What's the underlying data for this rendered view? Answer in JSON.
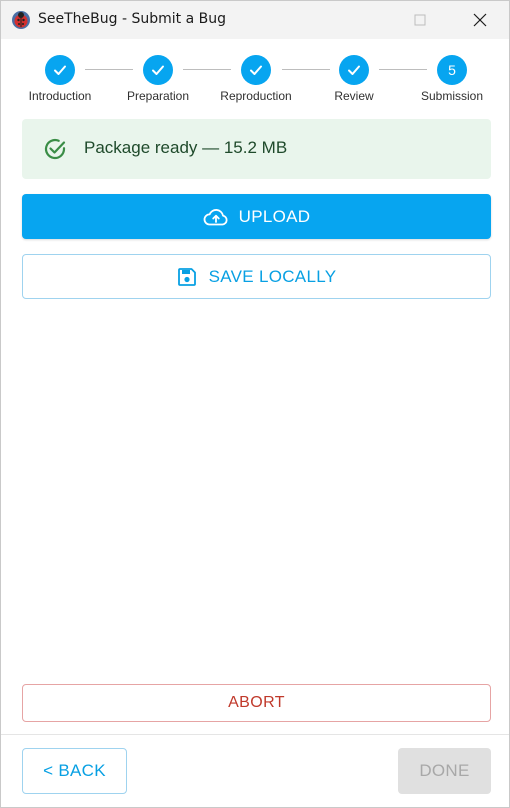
{
  "window": {
    "title": "SeeTheBug - Submit a Bug",
    "icon": "ladybug-icon"
  },
  "stepper": {
    "steps": [
      {
        "label": "Introduction",
        "state": "completed",
        "marker": "check"
      },
      {
        "label": "Preparation",
        "state": "completed",
        "marker": "check"
      },
      {
        "label": "Reproduction",
        "state": "completed",
        "marker": "check"
      },
      {
        "label": "Review",
        "state": "completed",
        "marker": "check"
      },
      {
        "label": "Submission",
        "state": "active",
        "marker": "5"
      }
    ]
  },
  "status": {
    "message": "Package ready — 15.2 MB",
    "icon": "check-circle-icon"
  },
  "actions": {
    "upload_label": "UPLOAD",
    "upload_icon": "cloud-upload-icon",
    "save_label": "SAVE LOCALLY",
    "save_icon": "floppy-disk-icon",
    "abort_label": "ABORT"
  },
  "footer": {
    "back_label": "< BACK",
    "done_label": "DONE",
    "done_disabled": true
  },
  "colors": {
    "accent": "#07a5f0",
    "success_bg": "#e9f5ec",
    "success_text": "#1f4a2b",
    "danger": "#c0392b",
    "disabled_bg": "#e0e0e0"
  }
}
